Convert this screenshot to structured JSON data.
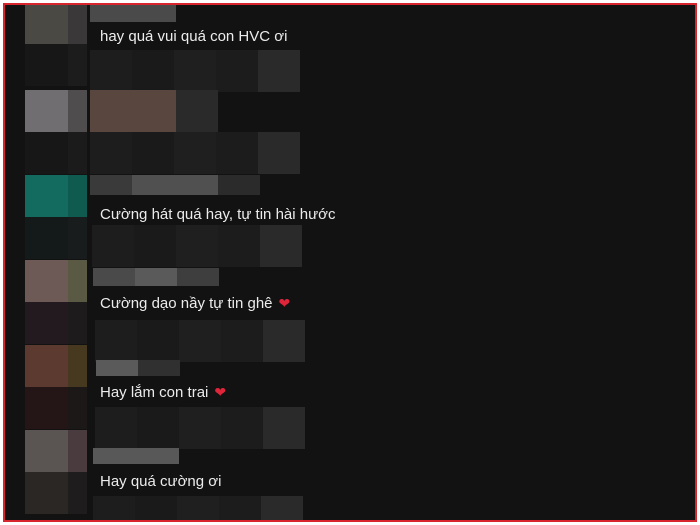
{
  "colors": {
    "border": "#d7262e",
    "background": "#121212",
    "text": "#ececec",
    "heart": "#e0253a"
  },
  "comments": [
    {
      "text": "hay quá vui quá con HVC ơi",
      "heart": false
    },
    {
      "text": "",
      "heart": false
    },
    {
      "text": "Cường hát quá hay, tự tin hài hước",
      "heart": false
    },
    {
      "text": "Cường dạo nầy tự tin ghê",
      "heart": true,
      "heart_icon": "heart-icon"
    },
    {
      "text": "Hay lắm con trai",
      "heart": true,
      "heart_icon": "heart-icon"
    },
    {
      "text": "Hay quá cường ơi",
      "heart": false
    }
  ]
}
